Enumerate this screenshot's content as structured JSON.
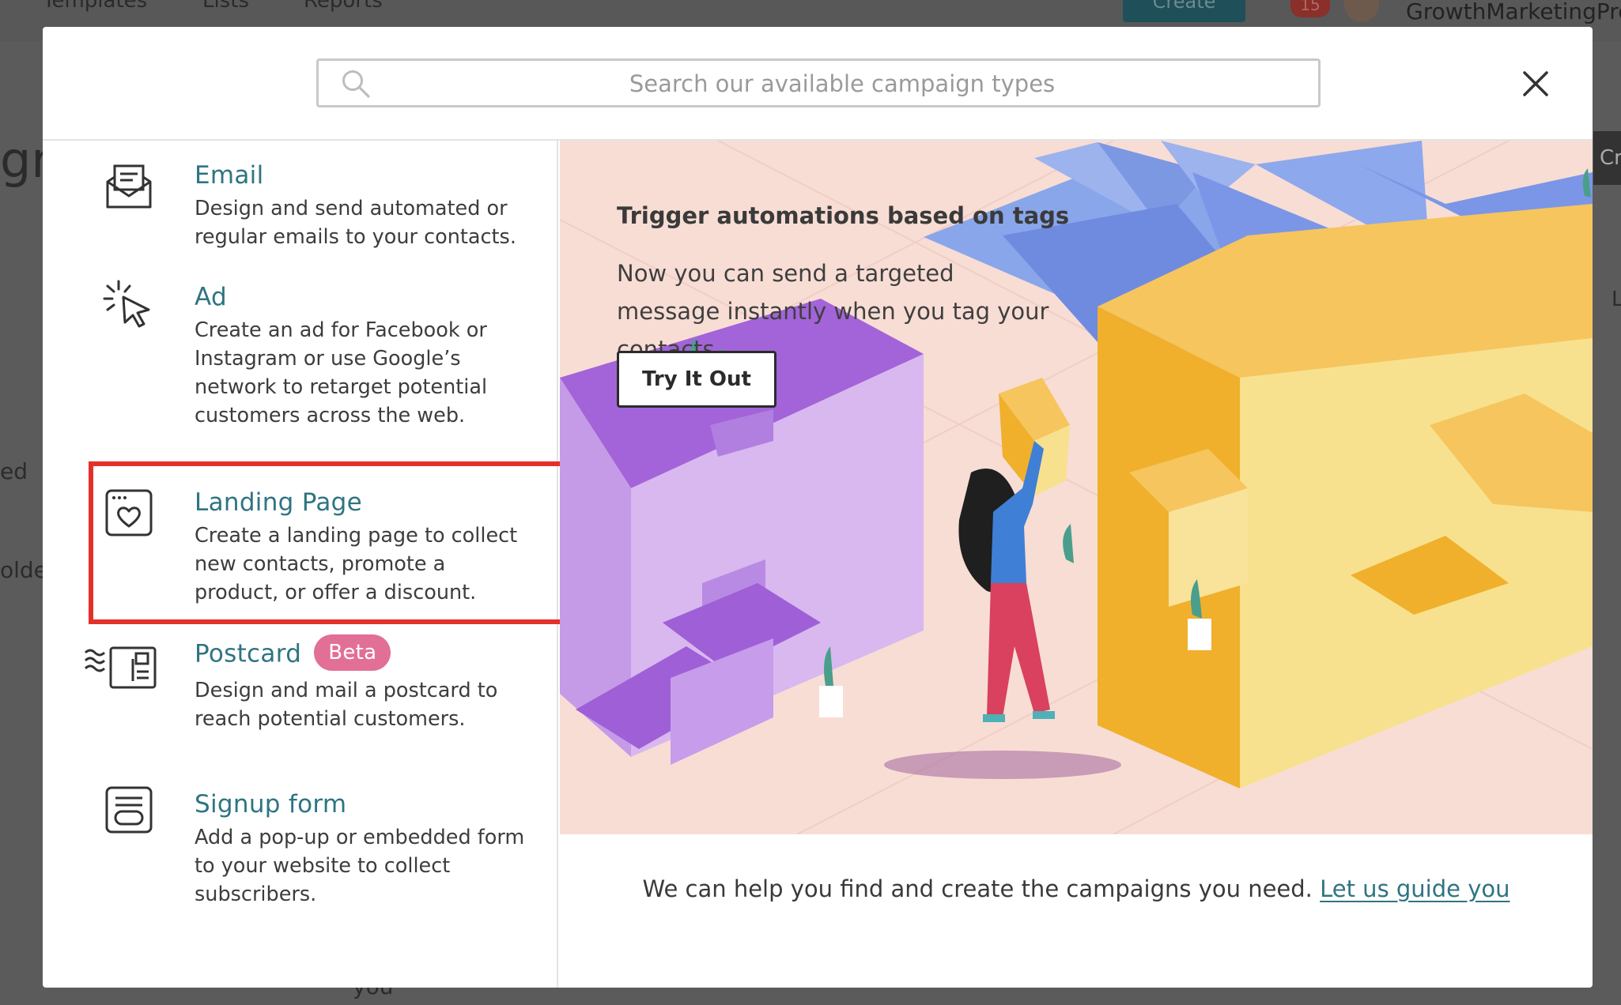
{
  "background_app": {
    "nav": [
      "Templates",
      "Lists",
      "Reports"
    ],
    "create_label": "Create",
    "notification_count": "15",
    "username": "GrowthMarketingPro.c",
    "fragments": [
      "gr",
      "ed",
      "older",
      "Cr",
      "L",
      "you"
    ]
  },
  "modal": {
    "search": {
      "placeholder": "Search our available campaign types",
      "value": ""
    },
    "close_icon": "close-icon",
    "campaign_types": [
      {
        "title": "Email",
        "description": "Design and send automated or regular emails to your contacts.",
        "icon": "envelope-icon"
      },
      {
        "title": "Ad",
        "description": "Create an ad for Facebook or Instagram or use Google’s network to retarget potential customers across the web.",
        "icon": "cursor-click-icon"
      },
      {
        "title": "Landing Page",
        "description": "Create a landing page to collect new contacts, promote a product, or offer a discount.",
        "icon": "landing-page-icon",
        "highlighted": true
      },
      {
        "title": "Postcard",
        "badge": "Beta",
        "description": "Design and mail a postcard to reach potential customers.",
        "icon": "postcard-icon"
      },
      {
        "title": "Signup form",
        "description": "Add a pop-up or embedded form to your website to collect subscribers.",
        "icon": "signup-form-icon"
      }
    ],
    "promo": {
      "title": "Trigger automations based on tags",
      "text": "Now you can send a targeted message instantly when you tag your contacts.",
      "button_label": "Try It Out"
    },
    "footer": {
      "text": "We can help you find and create the campaigns you need.",
      "link_label": "Let us guide you"
    }
  },
  "colors": {
    "link": "#2f7482",
    "beta_badge": "#e26f96",
    "highlight_border": "#e5302a",
    "promo_bg": "#f8ddd5"
  }
}
